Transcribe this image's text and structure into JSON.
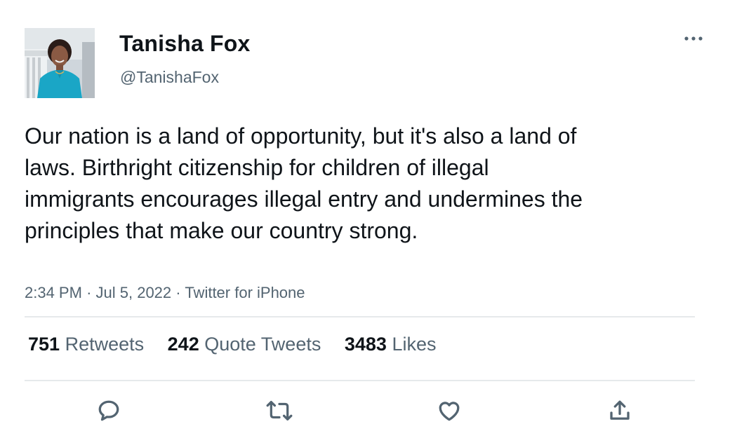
{
  "author": {
    "display_name": "Tanisha Fox",
    "handle": "@TanishaFox"
  },
  "more_icon": "more-horizontal-icon",
  "tweet": {
    "text": "Our nation is a land of opportunity, but it's also a land of laws. Birthright citizenship for children of illegal immigrants encourages illegal entry and undermines the principles that make our country strong.",
    "time": "2:34 PM",
    "separator": "·",
    "date": "Jul 5, 2022",
    "source": "Twitter for iPhone"
  },
  "stats": {
    "retweets": {
      "count": "751",
      "label": "Retweets"
    },
    "quotes": {
      "count": "242",
      "label": "Quote Tweets"
    },
    "likes": {
      "count": "3483",
      "label": "Likes"
    }
  },
  "actions": [
    {
      "name": "reply",
      "icon": "reply-icon"
    },
    {
      "name": "retweet",
      "icon": "retweet-icon"
    },
    {
      "name": "like",
      "icon": "heart-icon"
    },
    {
      "name": "share",
      "icon": "share-icon"
    }
  ],
  "colors": {
    "text": "#0f1419",
    "secondary": "#536471",
    "divider": "#e6e9eb",
    "avatar_jacket": "#1aa6c6"
  }
}
